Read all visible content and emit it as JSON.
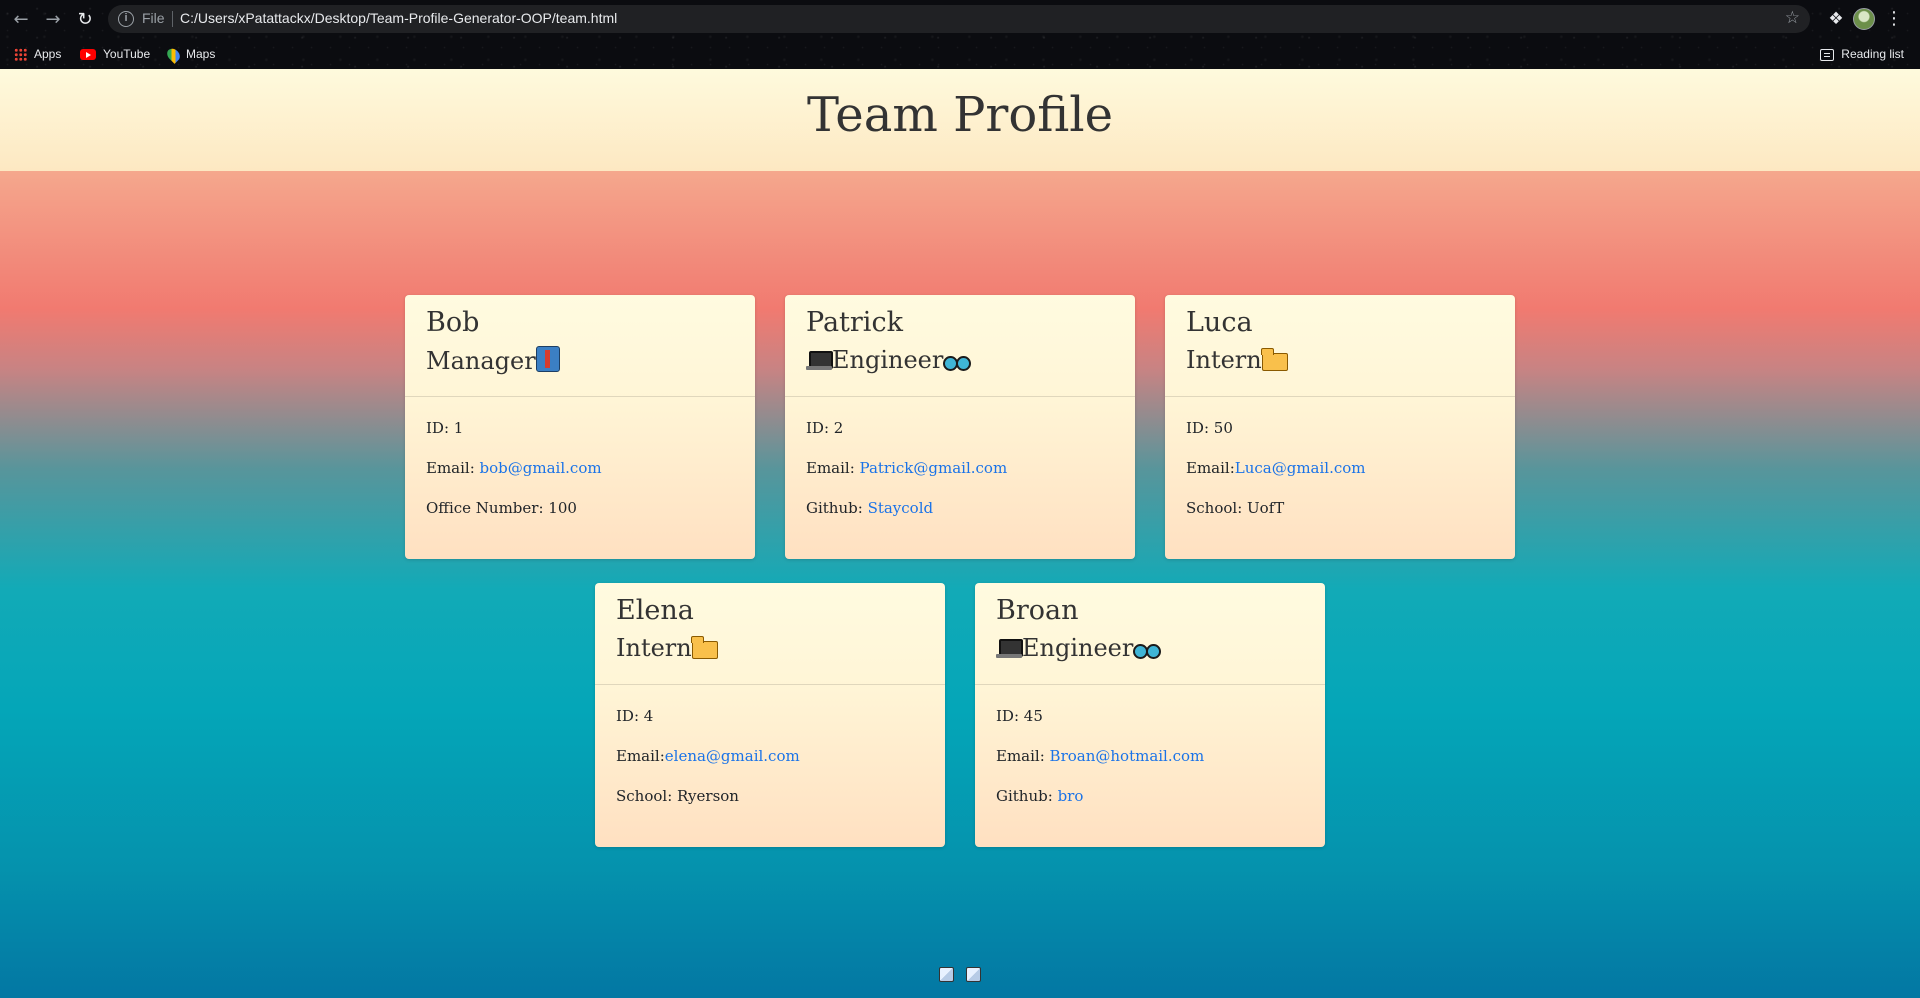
{
  "browser": {
    "omnibox": {
      "scheme_label": "File",
      "url": "C:/Users/xPatattackx/Desktop/Team-Profile-Generator-OOP/team.html"
    },
    "bookmarks": [
      {
        "label": "Apps",
        "icon": "apps-grid-icon"
      },
      {
        "label": "YouTube",
        "icon": "youtube-icon"
      },
      {
        "label": "Maps",
        "icon": "maps-icon"
      }
    ],
    "reading_list_label": "Reading list"
  },
  "page": {
    "title": "Team Profile",
    "colors": {
      "header_bg": "#fef8dc",
      "card_bg_top": "#fffbe0",
      "card_bg_bottom": "#ffe0c1",
      "link": "#1a73e8",
      "gradient_top": "#f4a189",
      "gradient_middle": "#f17a70",
      "gradient_bottom": "#0377a3"
    },
    "cards": [
      {
        "name": "Bob",
        "role": "Manager",
        "role_icons": [
          "necktie-icon"
        ],
        "id_line": "ID: 1",
        "email_label": "Email: ",
        "email": "bob@gmail.com",
        "extra_label": "Office Number: 100",
        "extra_link": ""
      },
      {
        "name": "Patrick",
        "role": "Engineer",
        "role_icons": [
          "laptop-icon",
          "goggles-icon"
        ],
        "id_line": "ID: 2",
        "email_label": "Email: ",
        "email": "Patrick@gmail.com",
        "extra_label": "Github: ",
        "extra_link": "Staycold"
      },
      {
        "name": "Luca",
        "role": "Intern",
        "role_icons": [
          "folder-icon"
        ],
        "id_line": "ID: 50",
        "email_label": "Email:",
        "email": "Luca@gmail.com",
        "extra_label": "School: UofT",
        "extra_link": ""
      },
      {
        "name": "Elena",
        "role": "Intern",
        "role_icons": [
          "folder-icon"
        ],
        "id_line": "ID: 4",
        "email_label": "Email:",
        "email": "elena@gmail.com",
        "extra_label": "School: Ryerson",
        "extra_link": ""
      },
      {
        "name": "Broan",
        "role": "Engineer",
        "role_icons": [
          "laptop-icon",
          "goggles-icon"
        ],
        "id_line": "ID: 45",
        "email_label": "Email: ",
        "email": "Broan@hotmail.com",
        "extra_label": "Github: ",
        "extra_link": "bro"
      }
    ],
    "footer": {
      "text": "",
      "icons": [
        "cube-icon",
        "cube-icon"
      ]
    }
  }
}
